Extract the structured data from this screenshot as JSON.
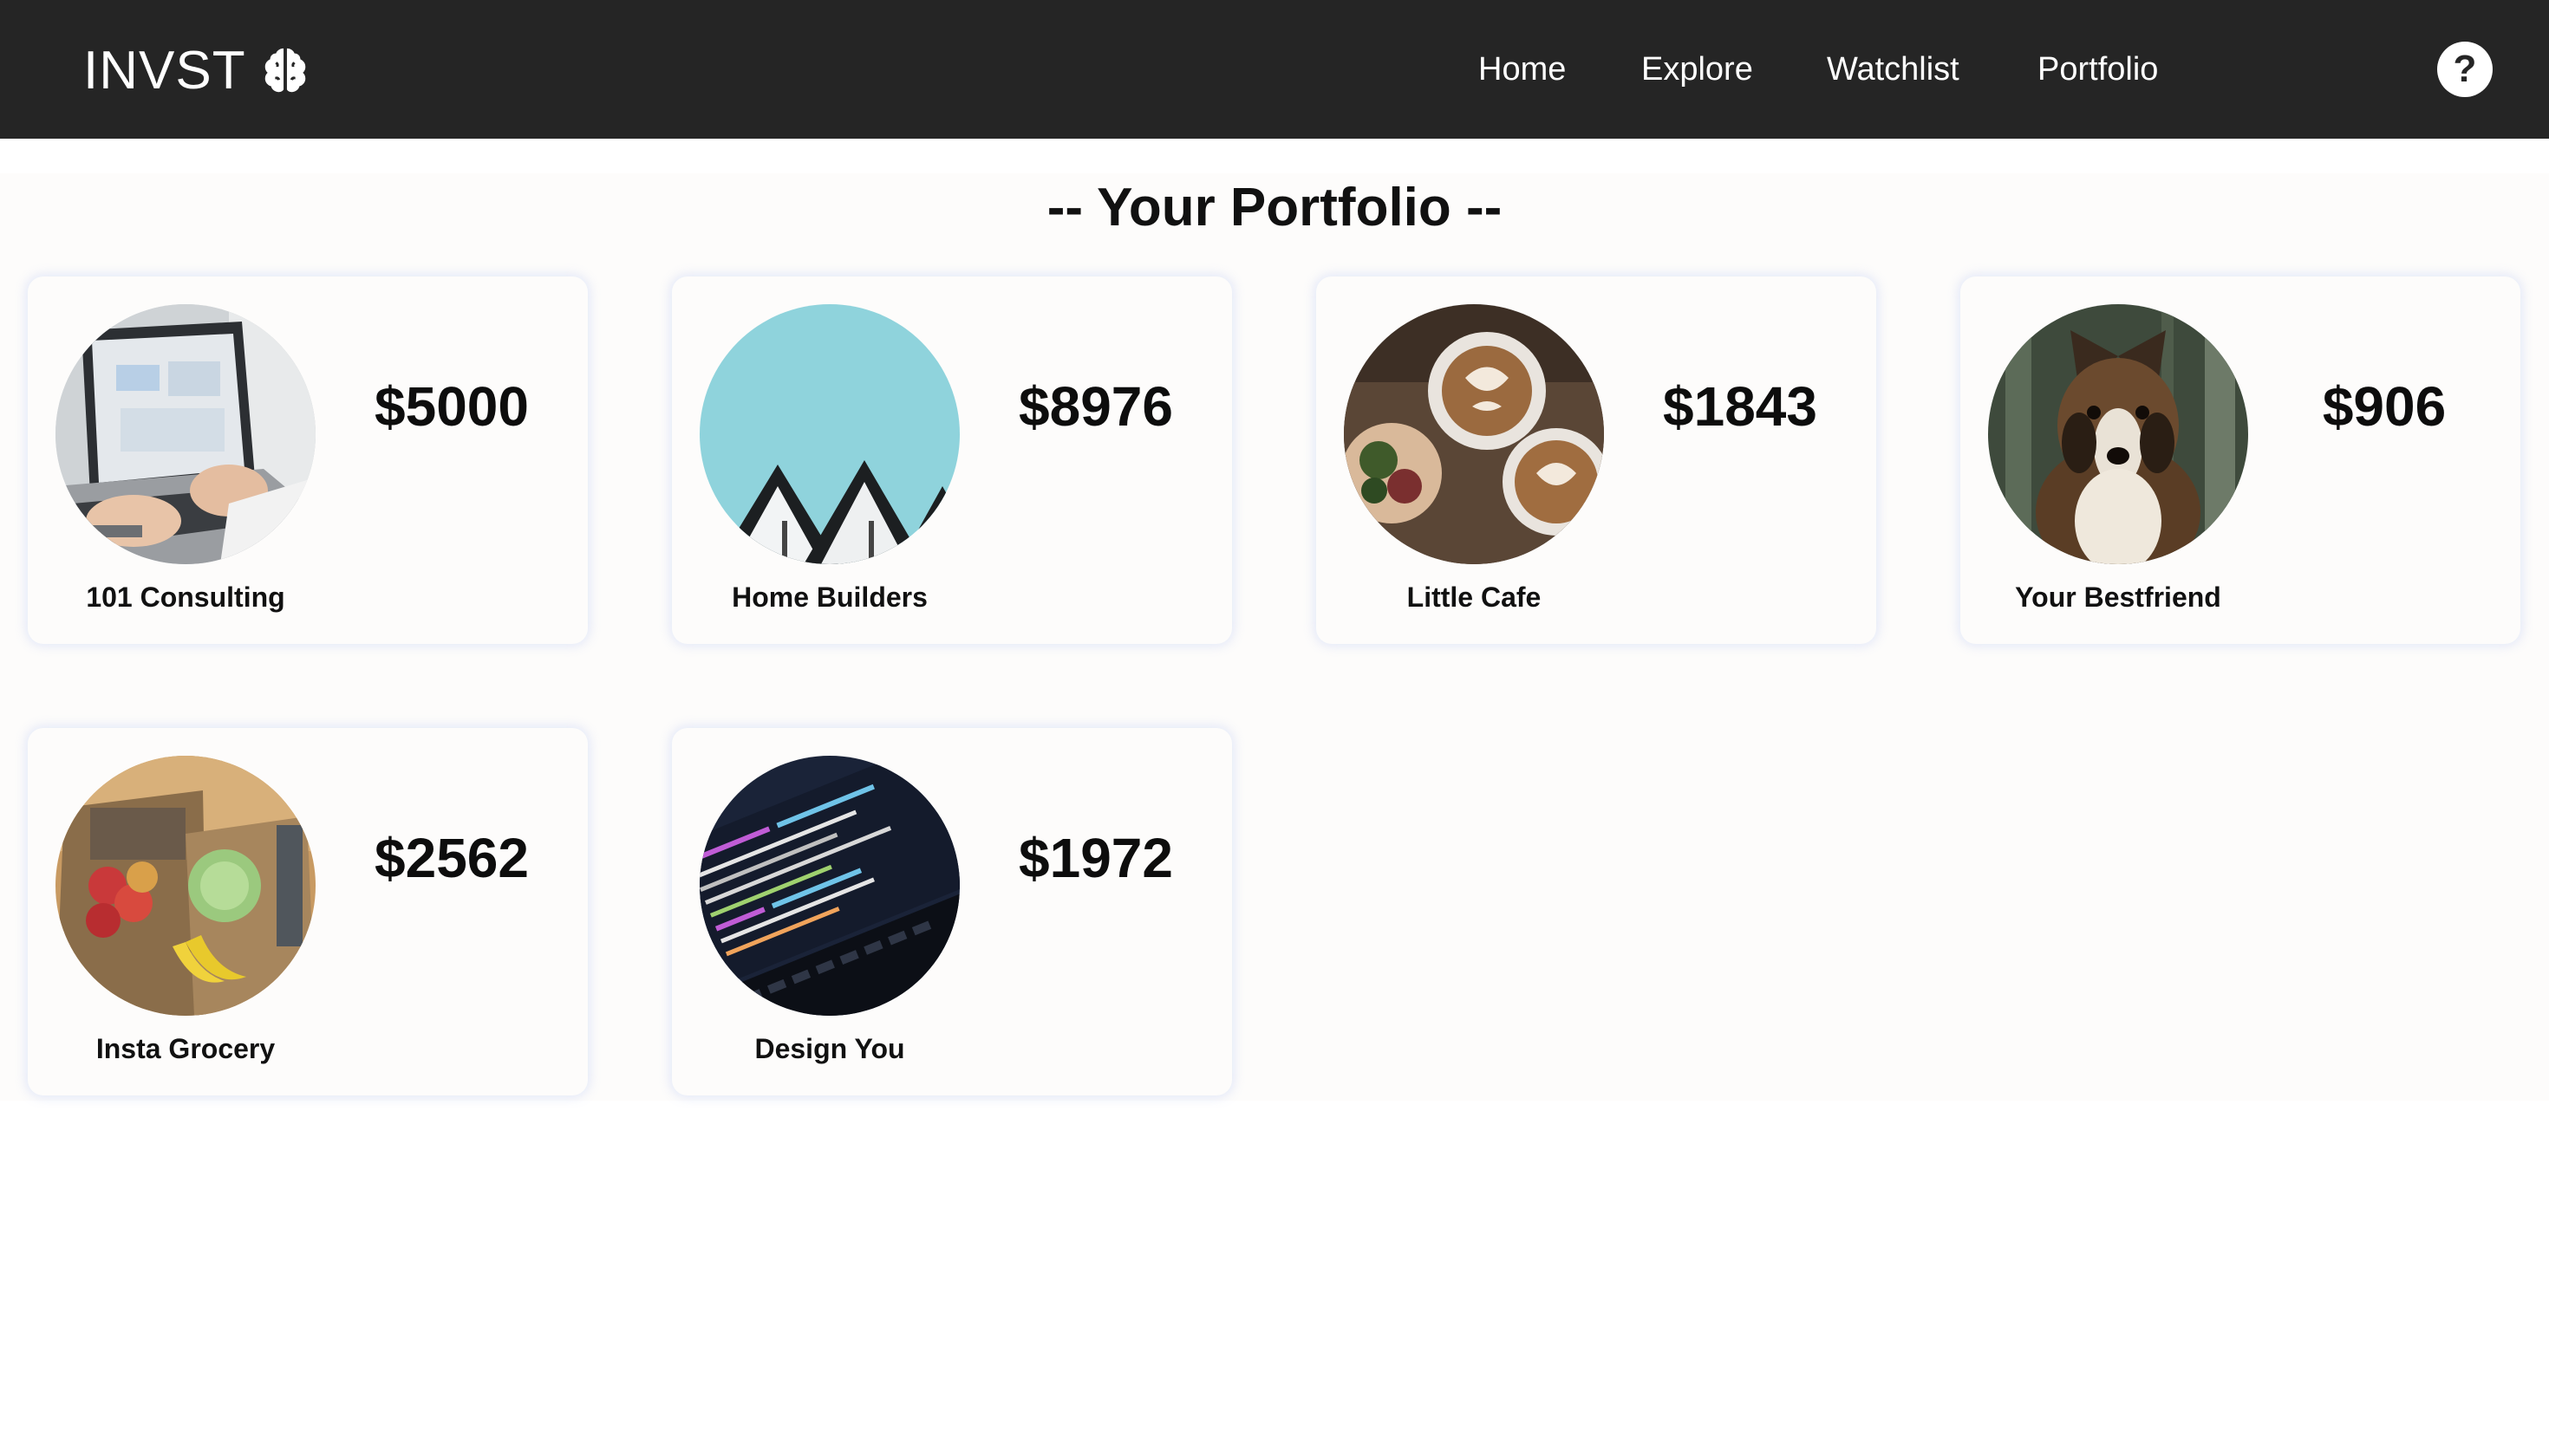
{
  "header": {
    "brand": "INVST",
    "brand_icon": "brain-icon",
    "nav": {
      "home": "Home",
      "explore": "Explore",
      "watchlist": "Watchlist",
      "portfolio": "Portfolio"
    },
    "help_label": "?",
    "background": "#252525"
  },
  "main": {
    "title": "-- Your Portfolio --",
    "cards": [
      {
        "name": "101 Consulting",
        "value": "$5000",
        "photo": "laptop-analytics-photo"
      },
      {
        "name": "Home Builders",
        "value": "$8976",
        "photo": "house-rooftops-photo"
      },
      {
        "name": "Little Cafe",
        "value": "$1843",
        "photo": "latte-coffee-photo"
      },
      {
        "name": "Your Bestfriend",
        "value": "$906",
        "photo": "dog-portrait-photo"
      },
      {
        "name": "Insta Grocery",
        "value": "$2562",
        "photo": "grocery-bags-photo"
      },
      {
        "name": "Design You",
        "value": "$1972",
        "photo": "code-screen-photo"
      }
    ]
  }
}
